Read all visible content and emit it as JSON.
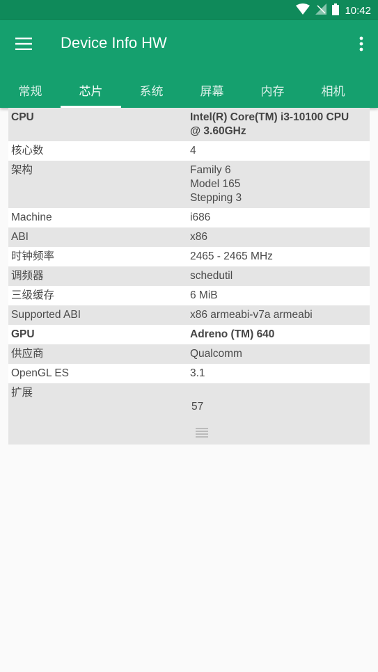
{
  "status_bar": {
    "time": "10:42",
    "icons": [
      "wifi-icon",
      "no-signal-icon",
      "battery-icon"
    ]
  },
  "app_bar": {
    "title": "Device Info HW",
    "menu_icon": "hamburger-menu-icon",
    "overflow_icon": "more-vert-icon",
    "color": "#15a06e"
  },
  "tabs": [
    {
      "label": "常规"
    },
    {
      "label": "芯片",
      "active": true
    },
    {
      "label": "系统"
    },
    {
      "label": "屏幕"
    },
    {
      "label": "内存"
    },
    {
      "label": "相机"
    }
  ],
  "rows": [
    {
      "label": "CPU",
      "value": "Intel(R) Core(TM) i3-10100 CPU\n@ 3.60GHz"
    },
    {
      "label": "核心数",
      "value": "4"
    },
    {
      "label": "架构",
      "value": "Family 6\nModel 165\nStepping 3"
    },
    {
      "label": "Machine",
      "value": "i686"
    },
    {
      "label": "ABI",
      "value": "x86"
    },
    {
      "label": "时钟频率",
      "value": "2465 - 2465 MHz"
    },
    {
      "label": "调频器",
      "value": "schedutil"
    },
    {
      "label": "三级缓存",
      "value": "6 MiB"
    },
    {
      "label": "Supported ABI",
      "value": "x86 armeabi-v7a armeabi"
    },
    {
      "label": "GPU",
      "value": "Adreno (TM) 640"
    },
    {
      "label": "供应商",
      "value": "Qualcomm"
    },
    {
      "label": "OpenGL ES",
      "value": "3.1"
    },
    {
      "label": "扩展",
      "value": "57",
      "icon": "list-icon"
    }
  ]
}
